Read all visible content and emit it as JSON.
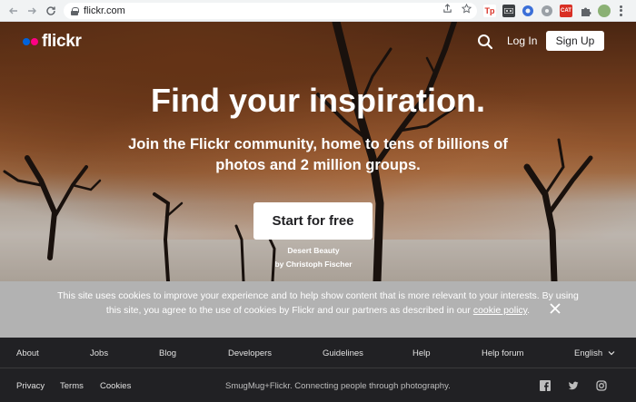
{
  "browser": {
    "url": "flickr.com",
    "back_icon": "arrow-left-icon",
    "forward_icon": "arrow-right-icon",
    "reload_icon": "reload-icon",
    "extensions": [
      "tp-ext",
      "rec-ext",
      "gear-ext",
      "circle-ext",
      "red-ext",
      "puzzle-icon",
      "avatar"
    ],
    "ext_labels": [
      "Tp",
      "",
      "",
      "",
      "CAT"
    ]
  },
  "header": {
    "logo_text": "flickr",
    "login_label": "Log In",
    "signup_label": "Sign Up"
  },
  "hero": {
    "headline": "Find your inspiration.",
    "subline": "Join the Flickr community, home to tens of billions of photos and 2 million groups.",
    "cta_label": "Start for free",
    "photo_title": "Desert Beauty",
    "photo_author": "by Christoph Fischer"
  },
  "cookie": {
    "text_before": "This site uses cookies to improve your experience and to help show content that is more relevant to your interests. By using this site, you agree to the use of cookies by Flickr and our partners as described in our ",
    "link_text": "cookie policy",
    "text_after": "."
  },
  "footer": {
    "row1": [
      "About",
      "Jobs",
      "Blog",
      "Developers",
      "Guidelines",
      "Help",
      "Help forum",
      "English"
    ],
    "row2": [
      "Privacy",
      "Terms",
      "Cookies"
    ],
    "tagline": "SmugMug+Flickr. Connecting people through photography."
  },
  "colors": {
    "flickr_blue": "#0063dc",
    "flickr_pink": "#ff0084",
    "footer_bg": "#212124",
    "cookie_bg": "#b2b2b2"
  }
}
